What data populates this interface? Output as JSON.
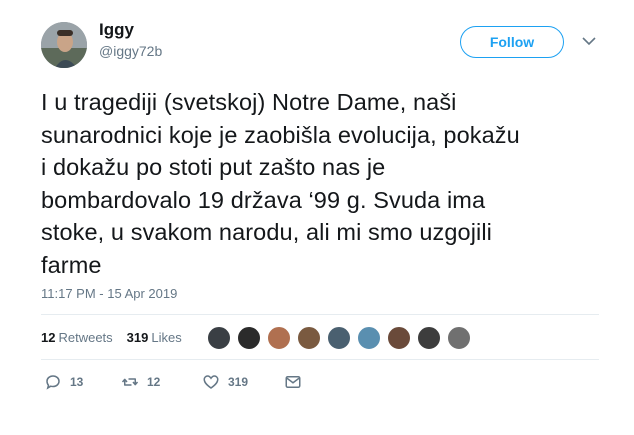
{
  "user": {
    "name": "Iggy",
    "handle": "@iggy72b"
  },
  "follow_label": "Follow",
  "tweet": {
    "text": "I u tragediji (svetskoj) Notre Dame, naši\nsunarodnici koje je zaobišla evolucija, pokažu\ni dokažu po stoti put zašto nas je\nbombardovalo 19 država ‘99 g. Svuda ima\nstoke, u svakom narodu, ali mi smo uzgojili\nfarme",
    "timestamp": "11:17 PM - 15 Apr 2019"
  },
  "stats": {
    "retweets_count": "12",
    "retweets_label": "Retweets",
    "likes_count": "319",
    "likes_label": "Likes"
  },
  "likers": [
    {
      "color": "#3a3f44"
    },
    {
      "color": "#2b2b2b"
    },
    {
      "color": "#b07050"
    },
    {
      "color": "#7a5a40"
    },
    {
      "color": "#4a6070"
    },
    {
      "color": "#5a8fb0"
    },
    {
      "color": "#6a4a3a"
    },
    {
      "color": "#3d3d3d"
    },
    {
      "color": "#707070"
    }
  ],
  "actions": {
    "replies": "13",
    "retweets": "12",
    "likes": "319"
  },
  "colors": {
    "accent": "#1da1f2",
    "secondary_text": "#657786",
    "divider": "#e6ecf0"
  },
  "icons": [
    "reply-icon",
    "retweet-icon",
    "like-icon",
    "message-icon",
    "chevron-down-icon"
  ]
}
